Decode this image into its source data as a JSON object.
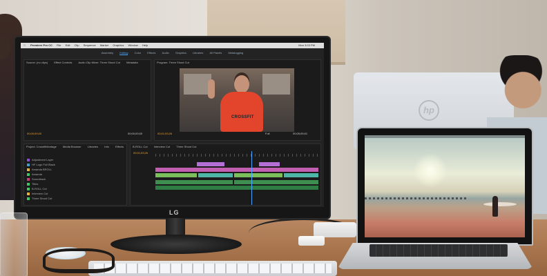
{
  "monitor": {
    "brand": "LG",
    "menubar": {
      "app": "Premiere Pro CC",
      "items": [
        "File",
        "Edit",
        "Clip",
        "Sequence",
        "Marker",
        "Graphics",
        "Window",
        "Help"
      ],
      "clock": "Mon 3:03 PM"
    },
    "workspaces": {
      "items": [
        "Assembly",
        "Editing",
        "Color",
        "Effects",
        "Audio",
        "Graphics",
        "Libraries",
        "All Panels",
        "Metalogging"
      ],
      "active": "Editing"
    },
    "source_panel": {
      "tabs": [
        "Source: (no clips)",
        "Effect Controls",
        "Audio Clip Mixer: Three Shoot Cut",
        "Metadata"
      ],
      "timecode_left": "00;00;00;00",
      "timecode_right": "00;00;00;00"
    },
    "program_panel": {
      "tab": "Program: Three Shoot Cut",
      "timecode_left": "00;01;53;26",
      "timecode_right": "00;05;05;01",
      "zoom": "Full",
      "shirt_text": "CROSSFIT"
    },
    "project_panel": {
      "tabs": [
        "Project: CrossfitMontage",
        "Media Browser",
        "Libraries",
        "Info",
        "Effects"
      ],
      "rows": [
        {
          "name": "Adjustment Layer",
          "color": "#8d4fd0"
        },
        {
          "name": "HF Logo Full Black",
          "color": "#3e9fcf"
        },
        {
          "name": "Amanda BROLL",
          "color": "#e8b13a"
        },
        {
          "name": "Amanda",
          "color": "#3ec765"
        },
        {
          "name": "Soundtrack",
          "color": "#c93e7a"
        },
        {
          "name": "Titles",
          "color": "#3ec765"
        },
        {
          "name": "B-ROLL Cut",
          "color": "#3ec765"
        },
        {
          "name": "Interview Cut",
          "color": "#e8b13a"
        },
        {
          "name": "Three Shoot Cut",
          "color": "#3ec765"
        }
      ]
    },
    "timeline_panel": {
      "tabs": [
        "B-ROLL Cut",
        "Interview Cut",
        "Three Shoot Cut"
      ],
      "timecode": "00;01;53;26"
    }
  },
  "laptop": {
    "wallpaper": "beach-surfer-sunset"
  },
  "other_monitor": {
    "logo": "hp"
  }
}
